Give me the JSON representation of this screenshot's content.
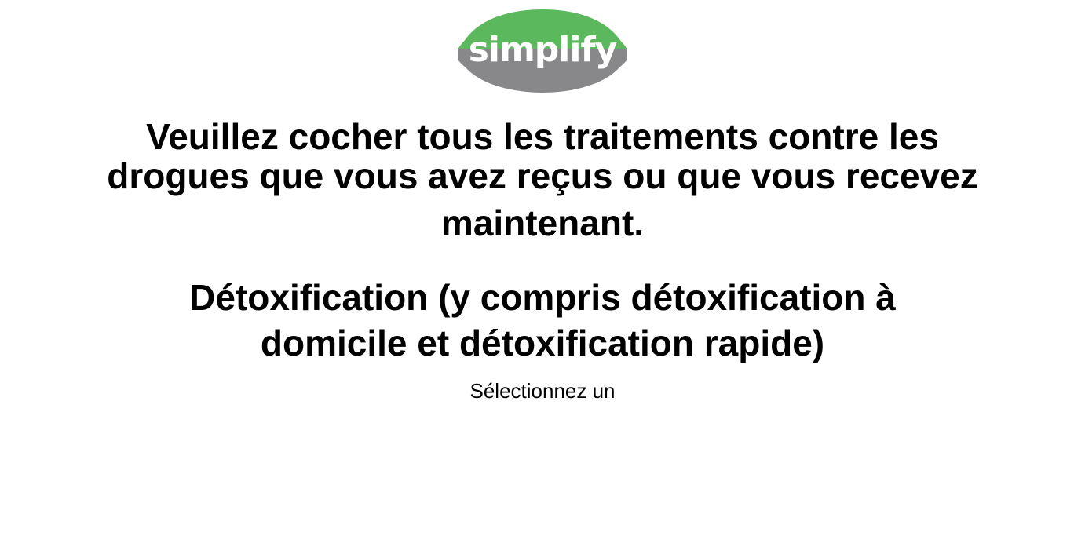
{
  "logo": {
    "text": "simplify",
    "colors": {
      "top": "#5cb85c",
      "bottom": "#888888",
      "text": "#ffffff"
    }
  },
  "question": {
    "line1": "Veuillez cocher tous les traitements contre les",
    "line2": "drogues que vous avez reçus ou que vous recevez",
    "line3": "maintenant."
  },
  "item": {
    "title_line1": "Détoxification (y compris détoxification à",
    "title_line2": "domicile et détoxification rapide)"
  },
  "selection": {
    "hint": "Sélectionnez un"
  }
}
